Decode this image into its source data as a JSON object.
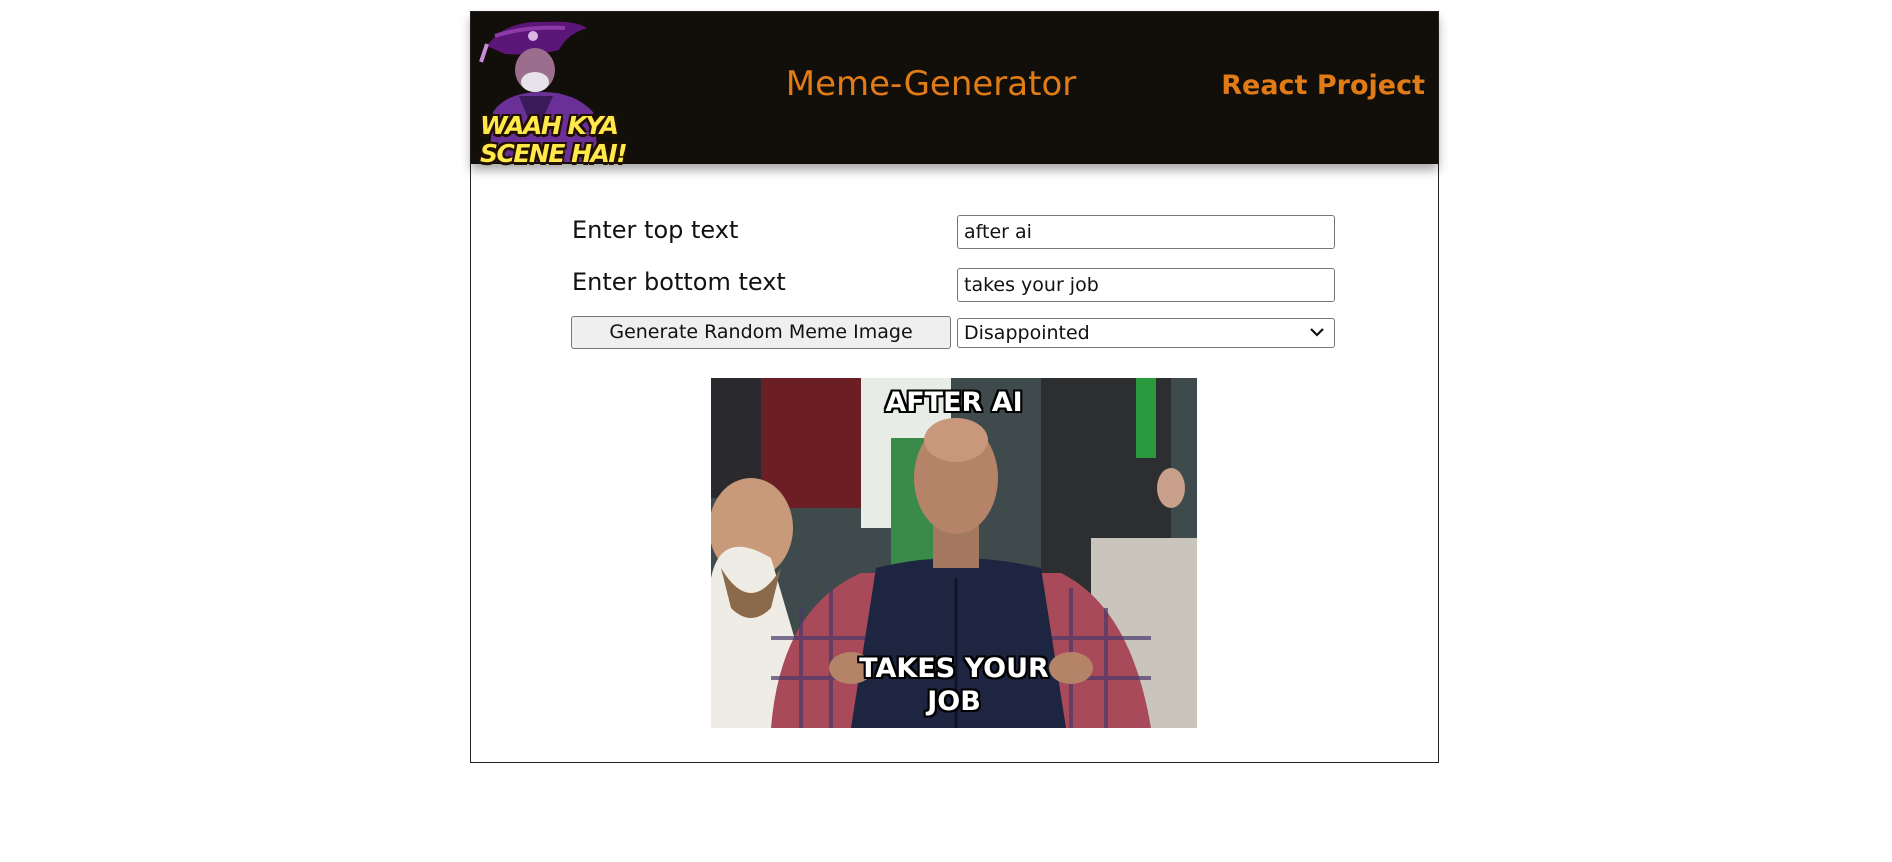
{
  "header": {
    "logo_text": "WAAH KYA SCENE HAI!",
    "title": "Meme-Generator",
    "subtitle": "React Project"
  },
  "form": {
    "top_label": "Enter top text",
    "top_value": "after ai",
    "bottom_label": "Enter bottom text",
    "bottom_value": "takes your job",
    "generate_label": "Generate Random Meme Image",
    "selected_meme": "Disappointed"
  },
  "meme": {
    "top_caption": "after ai",
    "bottom_caption": "takes your job"
  },
  "colors": {
    "header_bg": "#120e0a",
    "accent": "#e07b16",
    "logo_text": "#ffe94a"
  }
}
